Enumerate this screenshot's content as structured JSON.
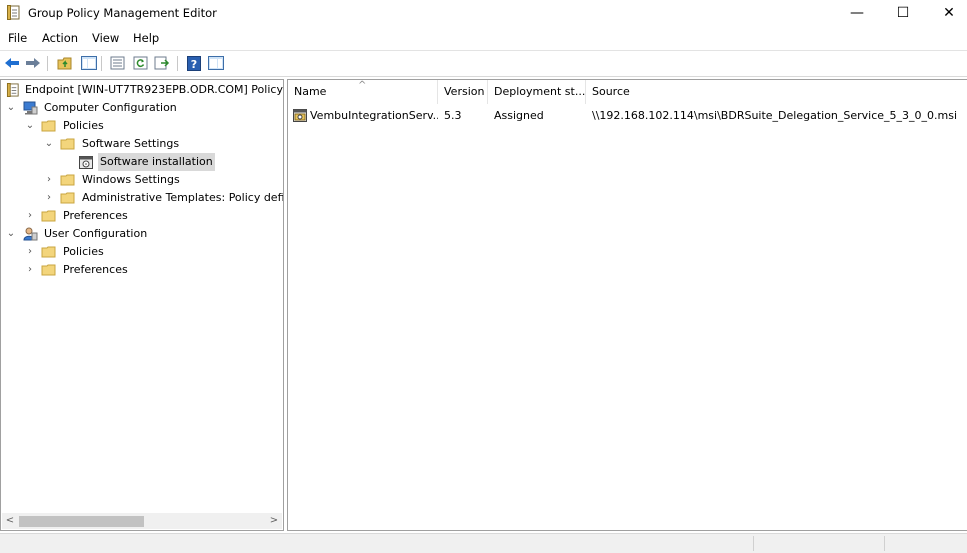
{
  "window": {
    "title": "Group Policy Management Editor",
    "icon": "policy-document-icon",
    "controls": {
      "minimize": "—",
      "maximize": "☐",
      "close": "✕"
    }
  },
  "menu": [
    "File",
    "Action",
    "View",
    "Help"
  ],
  "toolbar": [
    {
      "name": "back-icon"
    },
    {
      "name": "forward-icon"
    },
    {
      "name": "up-folder-icon"
    },
    {
      "name": "show-hide-tree-icon"
    },
    {
      "name": "properties-icon"
    },
    {
      "name": "refresh-icon"
    },
    {
      "name": "export-list-icon"
    },
    {
      "name": "help-icon"
    },
    {
      "name": "show-hide-action-pane-icon"
    }
  ],
  "tree": {
    "root": "Endpoint [WIN-UT7TR923EPB.ODR.COM] Policy",
    "computer_configuration": "Computer Configuration",
    "policies": "Policies",
    "software_settings": "Software Settings",
    "software_installation": "Software installation",
    "windows_settings": "Windows Settings",
    "admin_templates": "Administrative Templates: Policy defini",
    "preferences": "Preferences",
    "user_configuration": "User Configuration",
    "user_policies": "Policies",
    "user_preferences": "Preferences"
  },
  "list": {
    "columns": [
      "Name",
      "Version",
      "Deployment st...",
      "Source"
    ],
    "rows": [
      {
        "name": "VembuIntegrationServ...",
        "version": "5.3",
        "deployment": "Assigned",
        "source": "\\\\192.168.102.114\\msi\\BDRSuite_Delegation_Service_5_3_0_0.msi"
      }
    ]
  }
}
